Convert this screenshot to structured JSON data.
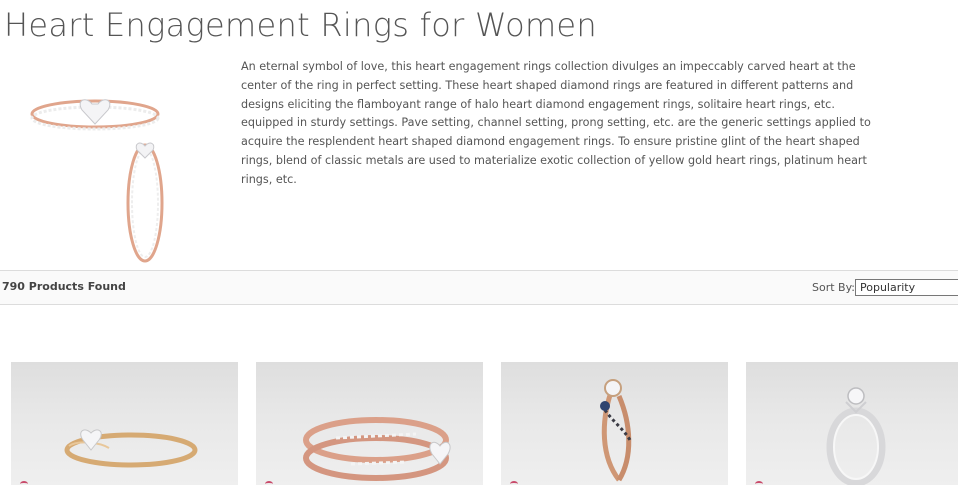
{
  "page": {
    "title": "Heart Engagement Rings for Women",
    "description": "An eternal symbol of love, this heart engagement rings collection divulges an impeccably carved heart at the center of the ring in perfect setting. These heart shaped diamond rings are featured in different patterns and designs eliciting the flamboyant range of halo heart diamond engagement rings, solitaire heart rings, etc. equipped in sturdy settings. Pave setting, channel setting, prong setting, etc. are the generic settings applied to acquire the resplendent heart shaped diamond engagement rings. To ensure pristine glint of the heart shaped rings, blend of classic metals are used to materialize exotic collection of yellow gold heart rings, platinum heart rings, etc."
  },
  "toolbar": {
    "products_found": "790 Products Found",
    "sort_label": "Sort By:",
    "sort_value": "Popularity"
  },
  "colors": {
    "rose_gold": "#d9a088",
    "yellow_gold": "#d8b07a",
    "white_gold": "#e0e0e0",
    "accent_mark": "#c84a6a"
  }
}
